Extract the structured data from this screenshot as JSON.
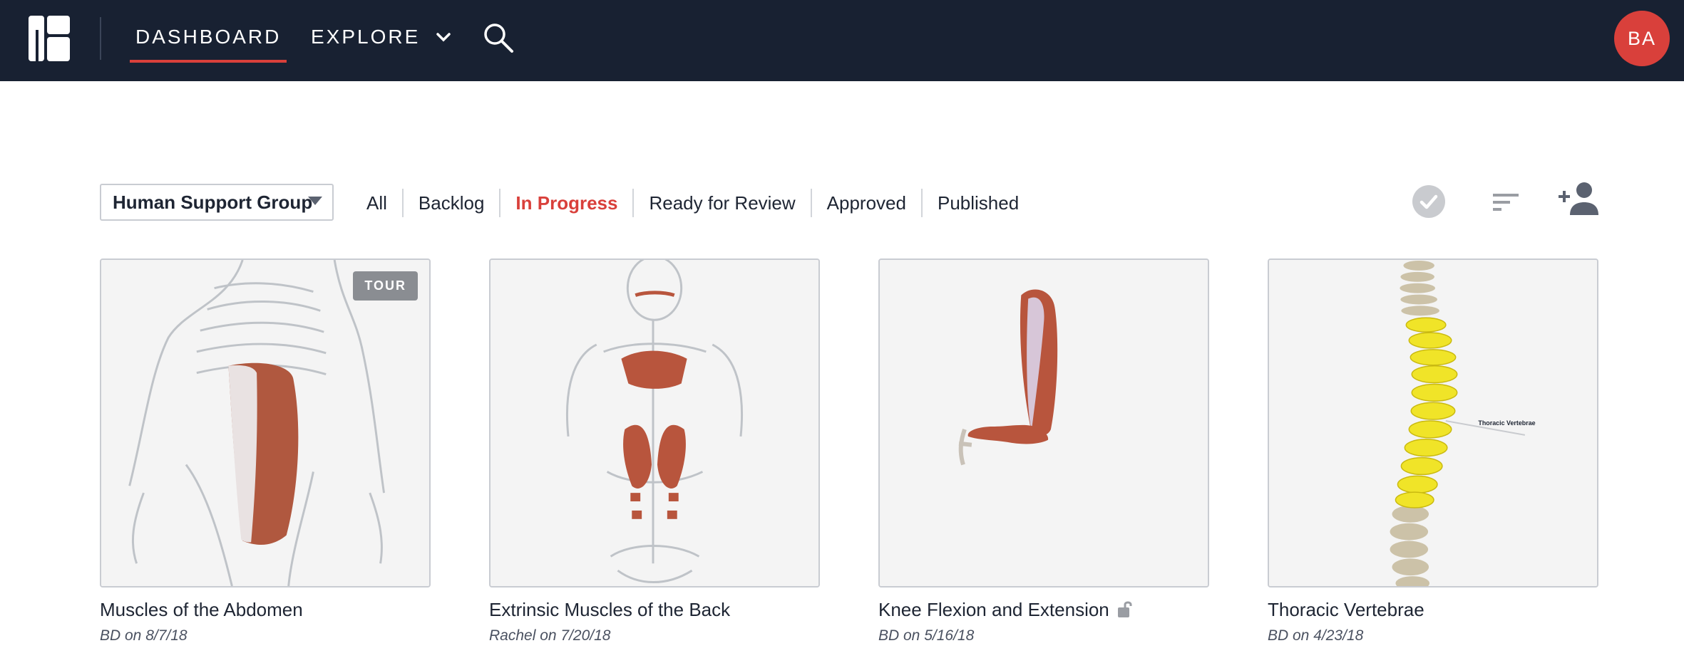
{
  "nav": {
    "dashboard": "DASHBOARD",
    "explore": "EXPLORE",
    "avatar_initials": "BA",
    "accent_color": "#d9403b",
    "bar_color": "#182132"
  },
  "filters": {
    "group": "Human Support Group",
    "tabs": [
      "All",
      "Backlog",
      "In Progress",
      "Ready for Review",
      "Approved",
      "Published"
    ],
    "active_tab": "In Progress"
  },
  "cards": [
    {
      "title": "Muscles of the Abdomen",
      "meta": "BD on 8/7/18",
      "badge": "TOUR"
    },
    {
      "title": "Extrinsic Muscles of the Back",
      "meta": "Rachel on 7/20/18"
    },
    {
      "title": "Knee Flexion and Extension",
      "meta": "BD on 5/16/18",
      "icon": "unlock-icon"
    },
    {
      "title": "Thoracic Vertebrae",
      "meta": "BD on 4/23/18",
      "image_label": "Thoracic Vertebrae"
    }
  ]
}
